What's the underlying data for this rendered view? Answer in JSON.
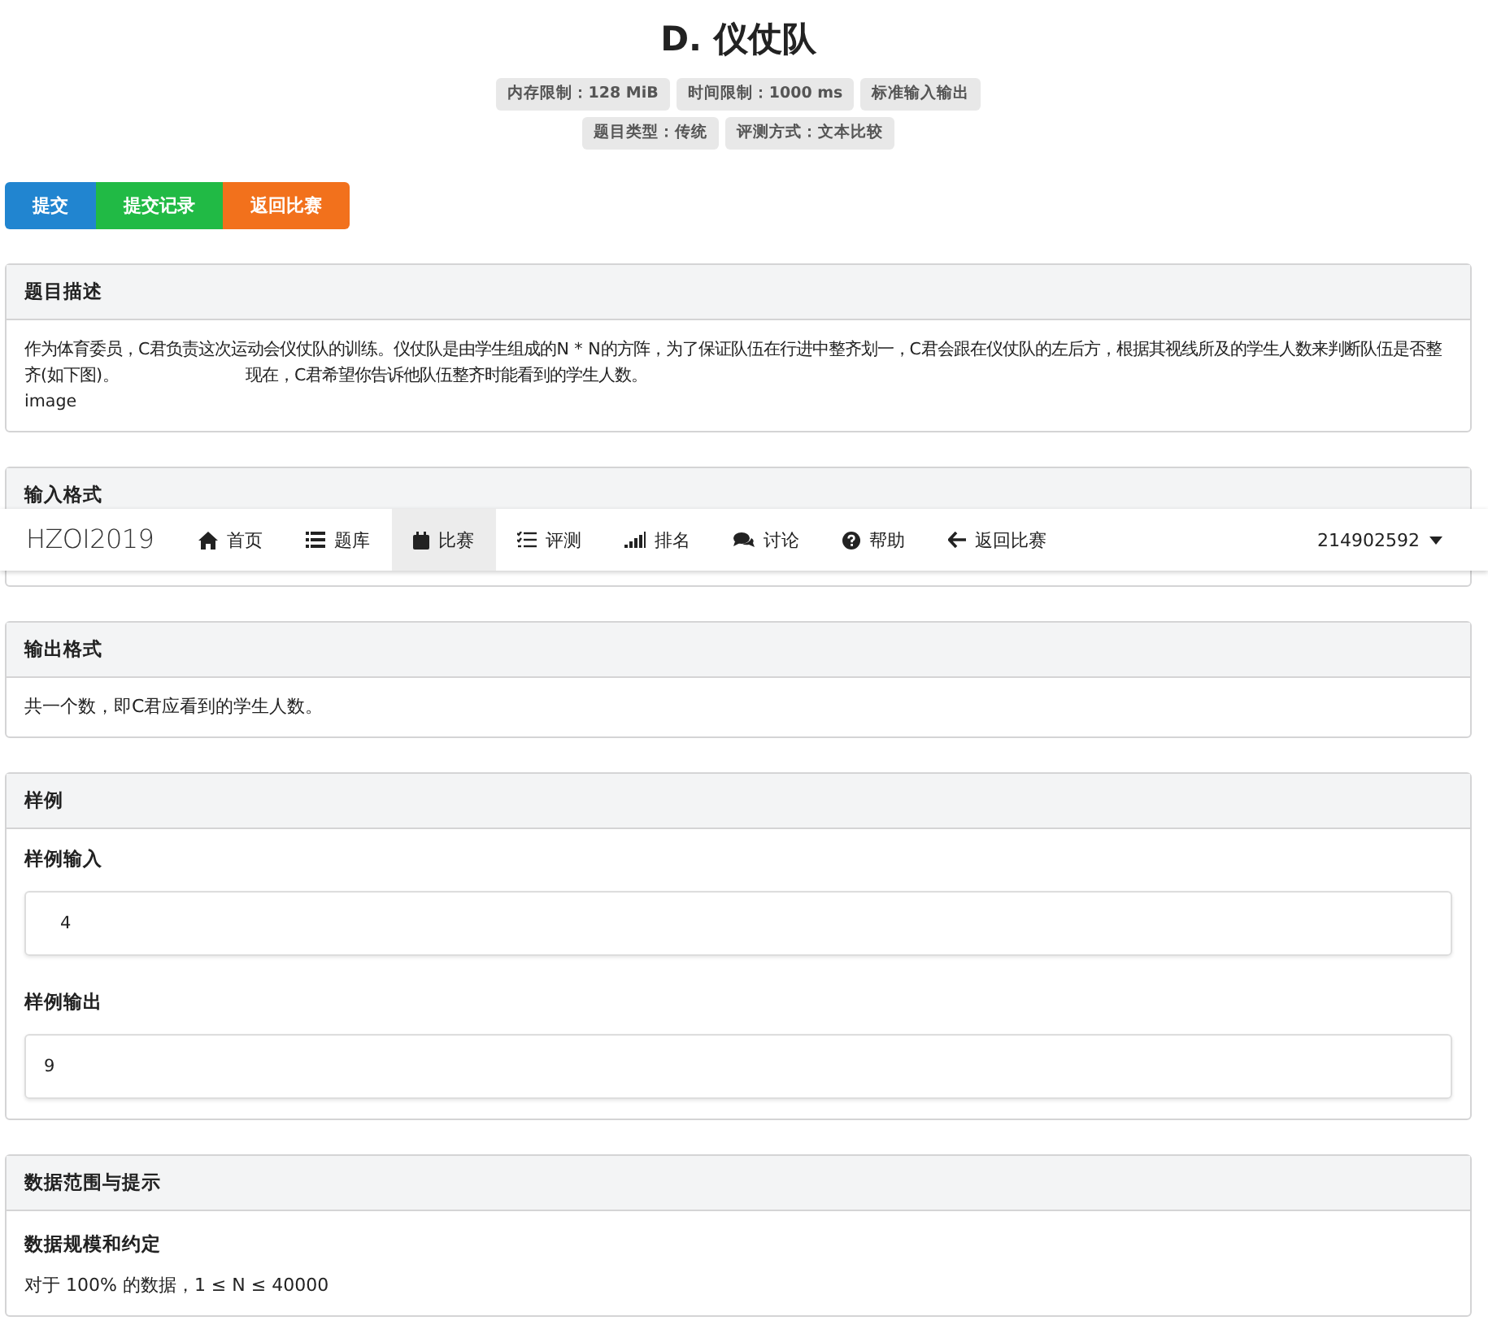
{
  "title": "D. 仪仗队",
  "badges": [
    [
      "内存限制：128 MiB",
      "时间限制：1000 ms",
      "标准输入输出"
    ],
    [
      "题目类型：传统",
      "评测方式：文本比较"
    ]
  ],
  "actions": [
    {
      "label": "提交",
      "kind": "blue"
    },
    {
      "label": "提交记录",
      "kind": "green"
    },
    {
      "label": "返回比赛",
      "kind": "orange"
    }
  ],
  "description": {
    "heading": "题目描述",
    "text_before": "作为体育委员，C君负责这次运动会仪仗队的训练。仪仗队是由学生组成的N * N的方阵，为了保证队伍在行进中整齐划一，C君会跟在仪仗队的左后方，根据其视线所及的学生人数来判断队伍是否整齐(如下图)。",
    "text_after": "现在，C君希望你告诉他队伍整齐时能看到的学生人数。",
    "image_alt": "image"
  },
  "input_format": {
    "heading": "输入格式"
  },
  "output_format": {
    "heading": "输出格式",
    "text": "共一个数，即C君应看到的学生人数。"
  },
  "samples": {
    "heading": "样例",
    "input_label": "样例输入",
    "input": "4",
    "output_label": "样例输出",
    "output": "9"
  },
  "limits": {
    "heading": "数据范围与提示",
    "subheading": "数据规模和约定",
    "text": "对于 100% 的数据，1 ≤ N ≤ 40000"
  },
  "navbar": {
    "brand": "HZOI2019",
    "items": [
      {
        "label": "首页",
        "kind": "home",
        "selected": false
      },
      {
        "label": "题库",
        "kind": "list",
        "selected": false
      },
      {
        "label": "比赛",
        "kind": "calendar",
        "selected": true
      },
      {
        "label": "评测",
        "kind": "tasks",
        "selected": false
      },
      {
        "label": "排名",
        "kind": "signal",
        "selected": false
      },
      {
        "label": "讨论",
        "kind": "comments",
        "selected": false
      },
      {
        "label": "帮助",
        "kind": "question",
        "selected": false
      },
      {
        "label": "返回比赛",
        "kind": "back",
        "selected": false
      }
    ],
    "user": "214902592"
  }
}
